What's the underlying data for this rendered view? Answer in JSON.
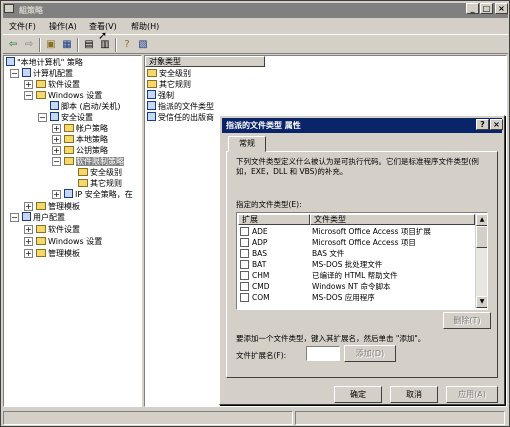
{
  "window": {
    "title": "組策略",
    "min": "_",
    "max": "□",
    "close": "×"
  },
  "menu": [
    {
      "label": "文件(F)"
    },
    {
      "label": "操作(A)"
    },
    {
      "label": "查看(V)"
    },
    {
      "label": "帮助(H)"
    }
  ],
  "toolbar": {
    "icons": [
      "back-icon",
      "forward-icon",
      "up-icon",
      "show-tree-icon",
      "properties-icon",
      "export-icon",
      "help-icon",
      "console-icon"
    ]
  },
  "tree": [
    {
      "label": "\"本地计算机\" 策略"
    },
    {
      "label": "计算机配置"
    },
    {
      "label": "软件设置"
    },
    {
      "label": "Windows 设置"
    },
    {
      "label": "脚本 (启动/关机)"
    },
    {
      "label": "安全设置"
    },
    {
      "label": "帐户策略"
    },
    {
      "label": "本地策略"
    },
    {
      "label": "公钥策略"
    },
    {
      "label": "软件限制策略"
    },
    {
      "label": "安全级别"
    },
    {
      "label": "其它规则"
    },
    {
      "label": "IP 安全策略，在"
    },
    {
      "label": "管理模板"
    },
    {
      "label": "用户配置"
    },
    {
      "label": "软件设置"
    },
    {
      "label": "Windows 设置"
    },
    {
      "label": "管理模板"
    }
  ],
  "list": {
    "header": "对象类型",
    "items": [
      {
        "label": "安全级别"
      },
      {
        "label": "其它规则"
      },
      {
        "label": "强制"
      },
      {
        "label": "指派的文件类型"
      },
      {
        "label": "受信任的出版商"
      }
    ]
  },
  "dialog": {
    "title": "指派的文件类型 属性",
    "help": "?",
    "close": "×",
    "tab": "常规",
    "description": "下列文件类型定义什么被认为是可执行代码。它们是标准程序文件类型(例如，EXE，DLL 和 VBS)的补充。",
    "list_label": "指定的文件类型(E):",
    "col_ext": "扩展",
    "col_type": "文件类型",
    "rows": [
      {
        "ext": "ADE",
        "type": "Microsoft Office Access 项目扩展"
      },
      {
        "ext": "ADP",
        "type": "Microsoft Office Access 项目"
      },
      {
        "ext": "BAS",
        "type": "BAS 文件"
      },
      {
        "ext": "BAT",
        "type": "MS-DOS 批处理文件"
      },
      {
        "ext": "CHM",
        "type": "已编译的 HTML 帮助文件"
      },
      {
        "ext": "CMD",
        "type": "Windows NT 命令脚本"
      },
      {
        "ext": "COM",
        "type": "MS-DOS 应用程序"
      }
    ],
    "delete_btn": "删除(T)",
    "add_hint": "要添加一个文件类型，键入其扩展名，然后单击 \"添加\"。",
    "ext_label": "文件扩展名(F):",
    "ext_value": "",
    "add_btn": "添加(D)",
    "ok": "确定",
    "cancel": "取消",
    "apply": "应用(A)"
  }
}
